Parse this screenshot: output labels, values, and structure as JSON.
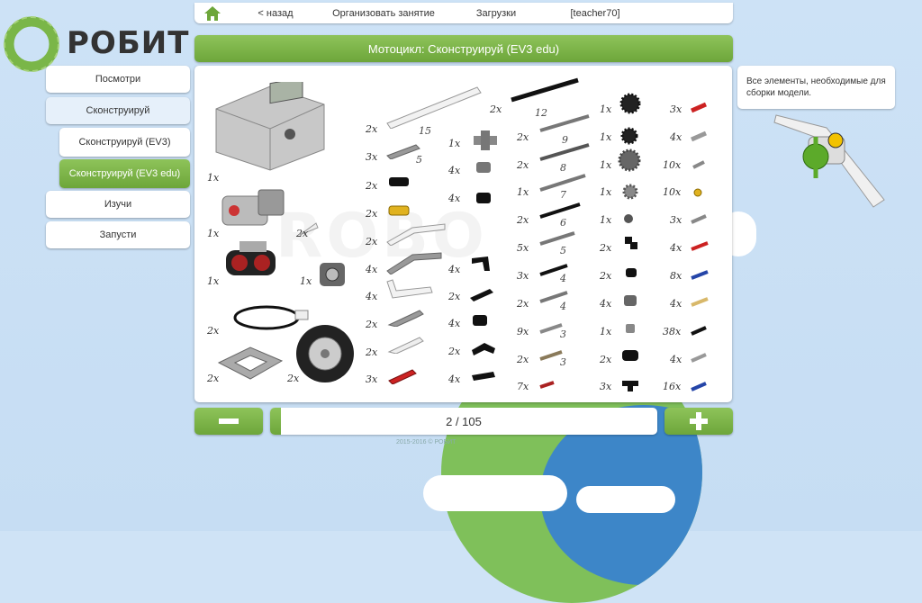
{
  "brand": {
    "name": "РОБИТ",
    "accent": "#7ab648"
  },
  "topnav": {
    "home_icon": "home-icon",
    "back": "< назад",
    "organize": "Организовать занятие",
    "downloads": "Загрузки",
    "user": "[teacher70]"
  },
  "title": "Мотоцикл: Сконструируй (EV3 edu)",
  "sidebar": {
    "items": [
      {
        "label": "Посмотри"
      },
      {
        "label": "Сконструируй"
      },
      {
        "label": "Сконструируй (EV3)"
      },
      {
        "label": "Сконструируй (EV3 edu)"
      },
      {
        "label": "Изучи"
      },
      {
        "label": "Запусти"
      }
    ]
  },
  "info": "Все элементы, необходимые для сборки модели.",
  "pager": {
    "label": "2 / 105",
    "value": 2,
    "total": 105
  },
  "footer": "2015-2016 © РОБИТ",
  "parts": {
    "col0": [
      "1x",
      "1x",
      "2x",
      "1x",
      "1x",
      "2x",
      "2x",
      "2x"
    ],
    "col1": [
      "2x",
      "3x",
      "2x",
      "2x",
      "2x",
      "4x",
      "4x",
      "2x",
      "2x",
      "3x"
    ],
    "col1_len": [
      "15",
      "5"
    ],
    "col2": [
      "1x",
      "4x",
      "4x",
      "4x",
      "2x",
      "4x",
      "2x",
      "4x"
    ],
    "col3": [
      "2x",
      "2x",
      "2x",
      "1x",
      "2x",
      "5x",
      "3x",
      "2x",
      "9x",
      "2x",
      "7x"
    ],
    "col3_len": [
      "12",
      "9",
      "8",
      "7",
      "6",
      "5",
      "4",
      "4",
      "3",
      "3"
    ],
    "col4": [
      "1x",
      "1x",
      "1x",
      "1x",
      "1x",
      "2x",
      "2x",
      "4x",
      "1x",
      "2x",
      "3x"
    ],
    "col5": [
      "3x",
      "4x",
      "10x",
      "10x",
      "3x",
      "4x",
      "8x",
      "4x",
      "38x",
      "4x",
      "16x"
    ]
  }
}
